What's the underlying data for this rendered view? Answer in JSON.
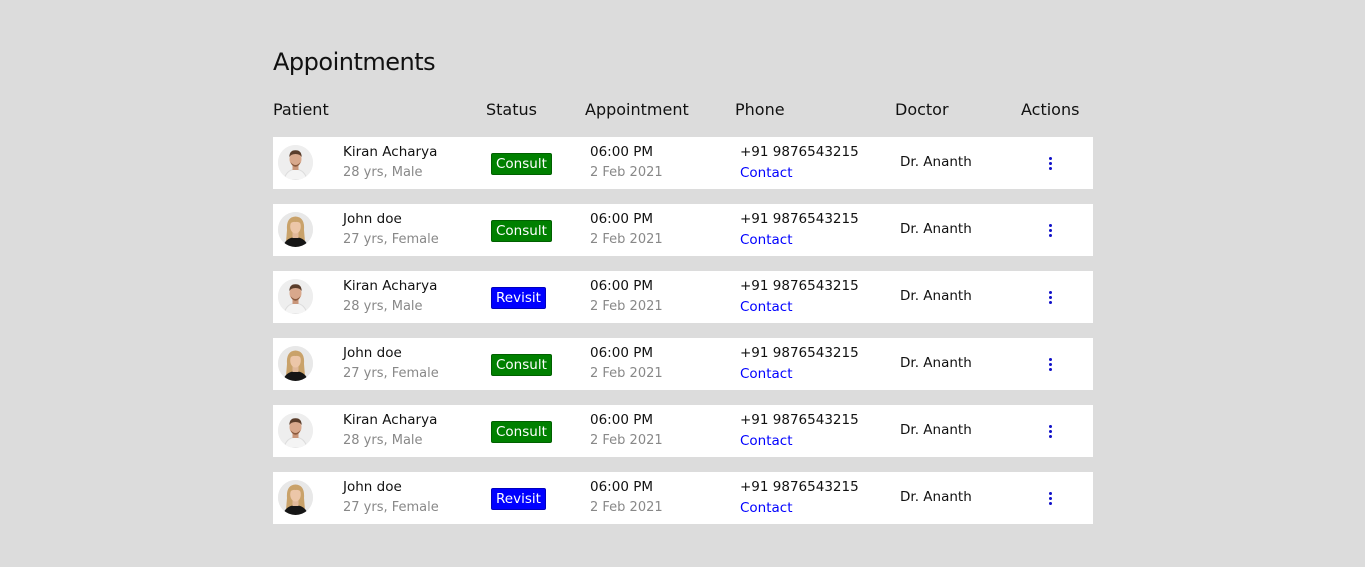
{
  "page": {
    "title": "Appointments"
  },
  "table": {
    "headers": {
      "patient": "Patient",
      "status": "Status",
      "appointment": "Appointment",
      "phone": "Phone",
      "doctor": "Doctor",
      "actions": "Actions"
    },
    "rows": [
      {
        "name": "Kiran Acharya",
        "details": "28 yrs, Male",
        "status": "Consult",
        "status_type": "consult",
        "time": "06:00 PM",
        "date": "2 Feb 2021",
        "phone": "+91 9876543215",
        "contact": "Contact",
        "doctor": "Dr. Ananth",
        "avatar_icon": "male-avatar-icon"
      },
      {
        "name": "John doe",
        "details": "27 yrs, Female",
        "status": "Consult",
        "status_type": "consult",
        "time": "06:00 PM",
        "date": "2 Feb 2021",
        "phone": "+91 9876543215",
        "contact": "Contact",
        "doctor": "Dr. Ananth",
        "avatar_icon": "female-avatar-icon"
      },
      {
        "name": "Kiran Acharya",
        "details": "28 yrs, Male",
        "status": "Revisit",
        "status_type": "revisit",
        "time": "06:00 PM",
        "date": "2 Feb 2021",
        "phone": "+91 9876543215",
        "contact": "Contact",
        "doctor": "Dr. Ananth",
        "avatar_icon": "male-avatar-icon"
      },
      {
        "name": "John doe",
        "details": "27 yrs, Female",
        "status": "Consult",
        "status_type": "consult",
        "time": "06:00 PM",
        "date": "2 Feb 2021",
        "phone": "+91 9876543215",
        "contact": "Contact",
        "doctor": "Dr. Ananth",
        "avatar_icon": "female-avatar-icon"
      },
      {
        "name": "Kiran Acharya",
        "details": "28 yrs, Male",
        "status": "Consult",
        "status_type": "consult",
        "time": "06:00 PM",
        "date": "2 Feb 2021",
        "phone": "+91 9876543215",
        "contact": "Contact",
        "doctor": "Dr. Ananth",
        "avatar_icon": "male-avatar-icon"
      },
      {
        "name": "John doe",
        "details": "27 yrs, Female",
        "status": "Revisit",
        "status_type": "revisit",
        "time": "06:00 PM",
        "date": "2 Feb 2021",
        "phone": "+91 9876543215",
        "contact": "Contact",
        "doctor": "Dr. Ananth",
        "avatar_icon": "female-avatar-icon"
      }
    ]
  },
  "colors": {
    "background": "#dcdcdc",
    "row_background": "#ffffff",
    "consult": "#008000",
    "revisit": "#0000ff",
    "link": "#0000ff",
    "muted_text": "#888888"
  },
  "icons": {
    "actions": "more-vertical-icon"
  }
}
